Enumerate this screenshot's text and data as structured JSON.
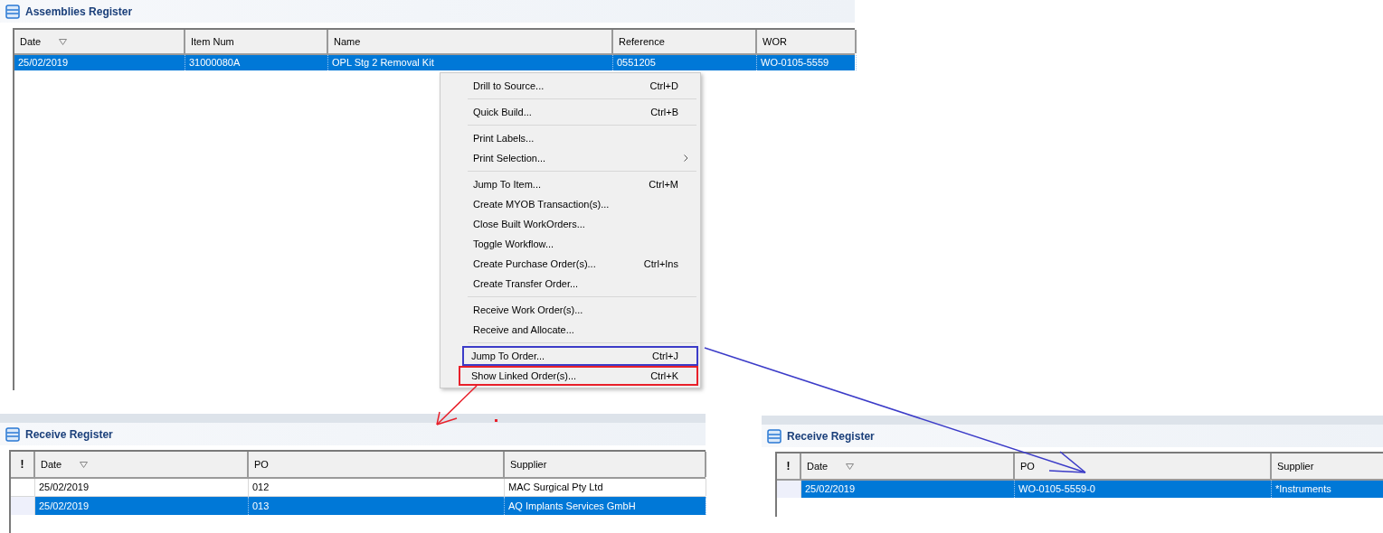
{
  "panels": [
    {
      "title": "Assemblies Register",
      "columns": [
        {
          "label": "Date",
          "sorted": true
        },
        {
          "label": "Item Num",
          "sorted": false
        },
        {
          "label": "Name",
          "sorted": false
        },
        {
          "label": "Reference",
          "sorted": false
        },
        {
          "label": "WOR",
          "sorted": false
        }
      ],
      "rows": [
        {
          "selected": true,
          "cells": [
            "25/02/2019",
            "31000080A",
            "OPL Stg 2 Removal Kit",
            "0551205",
            "WO-0105-5559"
          ]
        }
      ]
    },
    {
      "title": "Receive Register",
      "status_header": "!",
      "columns": [
        {
          "label": "Date",
          "sorted": true
        },
        {
          "label": "PO",
          "sorted": false
        },
        {
          "label": "Supplier",
          "sorted": false
        }
      ],
      "rows": [
        {
          "selected": false,
          "cells": [
            "25/02/2019",
            "012",
            "MAC Surgical Pty Ltd"
          ]
        },
        {
          "selected": true,
          "cells": [
            "25/02/2019",
            "013",
            "AQ Implants Services GmbH"
          ]
        }
      ]
    },
    {
      "title": "Receive Register",
      "status_header": "!",
      "columns": [
        {
          "label": "Date",
          "sorted": true
        },
        {
          "label": "PO",
          "sorted": false
        },
        {
          "label": "Supplier",
          "sorted": false
        }
      ],
      "rows": [
        {
          "selected": true,
          "cells": [
            "25/02/2019",
            "WO-0105-5559-0",
            "*Instruments"
          ]
        }
      ]
    }
  ],
  "context_menu": {
    "groups": [
      [
        {
          "label": "Drill to Source...",
          "shortcut": "Ctrl+D",
          "submenu": false
        }
      ],
      [
        {
          "label": "Quick Build...",
          "shortcut": "Ctrl+B",
          "submenu": false
        }
      ],
      [
        {
          "label": "Print Labels...",
          "submenu": false
        },
        {
          "label": "Print Selection...",
          "submenu": true
        }
      ],
      [
        {
          "label": "Jump To Item...",
          "shortcut": "Ctrl+M",
          "submenu": false
        },
        {
          "label": "Create MYOB Transaction(s)...",
          "submenu": false
        },
        {
          "label": "Close Built WorkOrders...",
          "submenu": false
        },
        {
          "label": "Toggle Workflow...",
          "submenu": false
        },
        {
          "label": "Create Purchase Order(s)...",
          "shortcut": "Ctrl+Ins",
          "submenu": false
        },
        {
          "label": "Create Transfer Order...",
          "submenu": false
        }
      ],
      [
        {
          "label": "Receive Work Order(s)...",
          "submenu": false
        },
        {
          "label": "Receive and Allocate...",
          "submenu": false
        }
      ],
      [
        {
          "label": "Jump To Order...",
          "shortcut": "Ctrl+J",
          "submenu": false,
          "color": "#3c3cc8"
        },
        {
          "label": "Show Linked Order(s)...",
          "shortcut": "Ctrl+K",
          "submenu": false,
          "color": "#e8202a"
        }
      ]
    ]
  }
}
